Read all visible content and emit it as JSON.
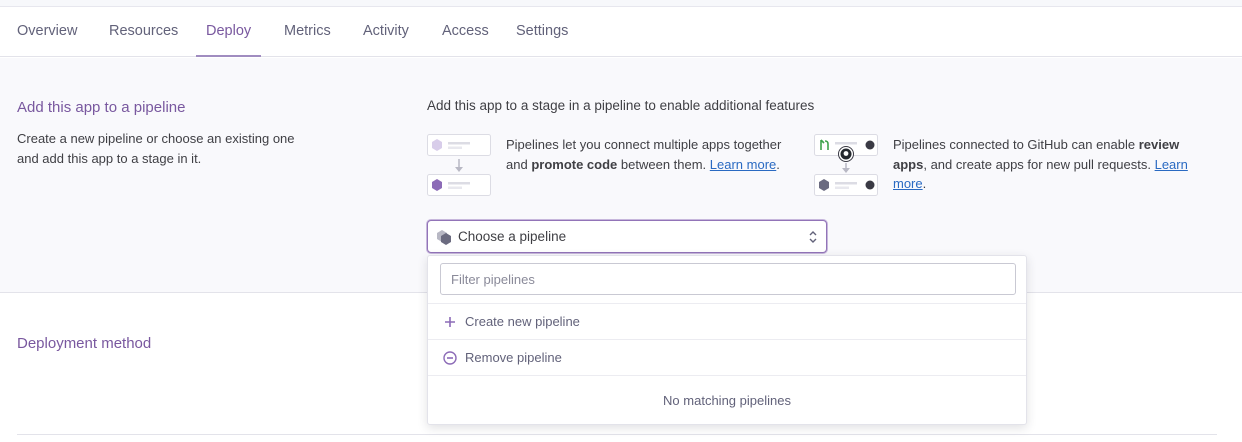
{
  "tabs": [
    "Overview",
    "Resources",
    "Deploy",
    "Metrics",
    "Activity",
    "Access",
    "Settings"
  ],
  "active_tab": "Deploy",
  "pipeline": {
    "title": "Add this app to a pipeline",
    "description": "Create a new pipeline or choose an existing one and add this app to a stage in it.",
    "intro": "Add this app to a stage in a pipeline to enable additional features",
    "feature1": {
      "text_before": "Pipelines let you connect multiple apps together and ",
      "bold": "promote code",
      "text_after": " between them. ",
      "link": "Learn more",
      "end": "."
    },
    "feature2": {
      "text_before": "Pipelines connected to GitHub can enable ",
      "bold": "review apps",
      "text_after": ", and create apps for new pull requests. ",
      "link": "Learn more",
      "end": "."
    },
    "select_label": "Choose a pipeline"
  },
  "dropdown": {
    "filter_placeholder": "Filter pipelines",
    "create_label": "Create new pipeline",
    "remove_label": "Remove pipeline",
    "empty_text": "No matching pipelines"
  },
  "deployment": {
    "title": "Deployment method"
  },
  "colors": {
    "brand_purple": "#79589f",
    "link_blue": "#2a6ac2",
    "icon_purple": "#8c6bb7"
  }
}
